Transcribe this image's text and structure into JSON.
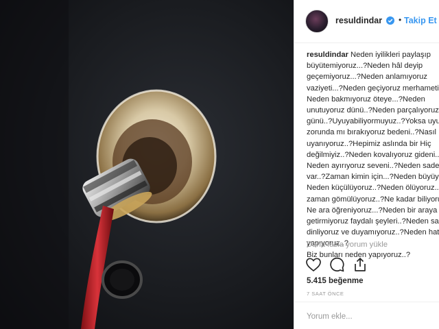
{
  "post": {
    "username": "resuldindar",
    "separator": "•",
    "follow_label": "Takip Et",
    "caption_author": "resuldindar",
    "caption_lines": [
      "Neden iyilikleri paylaşıp",
      "büyütemiyoruz...?Neden hâl deyip",
      "geçemiyoruz...?Neden anlamıyoruz",
      "vaziyeti...?Neden geçiyoruz merhameti..?",
      "Neden bakmıyoruz öteye...?Neden",
      "unutuyoruz dünü..?Neden parçalıyoruz",
      "günü..?Uyuyabiliyormuyuz..?Yoksa uyumak",
      "zorunda mı bırakıyoruz bedeni..?Nasıl",
      "uyanıyoruz..?Hepimiz aslında bir Hiç",
      "değilmiyiz..?Neden kovalıyoruz gideni..?",
      "Neden ayırıyoruz seveni..?Neden sadece",
      "var..?Zaman kimin için...?Neden büyüyoruz",
      "Neden küçülüyoruz..?Neden ölüyoruz..?",
      "zaman gömülüyoruz..?Ne kadar biliyoruz",
      "Ne ara öğreniyoruz...?Neden bir araya",
      "getirmiyoruz faydalı şeyleri..?Neden sadece",
      "dinliyoruz ve duyamıyoruz..?Neden hata",
      "yapıyoruz..?",
      "Biz bunları neden yapıyoruz..?"
    ],
    "load_more": "Daha fazla yorum yükle",
    "likes": "5.415 beğenme",
    "time": "7 SAAT ÖNCE",
    "comment_placeholder": "Yorum ekle..."
  },
  "colors": {
    "follow": "#3897f0",
    "verified": "#3897f0",
    "cable": "#c4242a"
  },
  "icons": [
    "heart-icon",
    "comment-icon",
    "share-icon",
    "verified-badge-icon"
  ]
}
